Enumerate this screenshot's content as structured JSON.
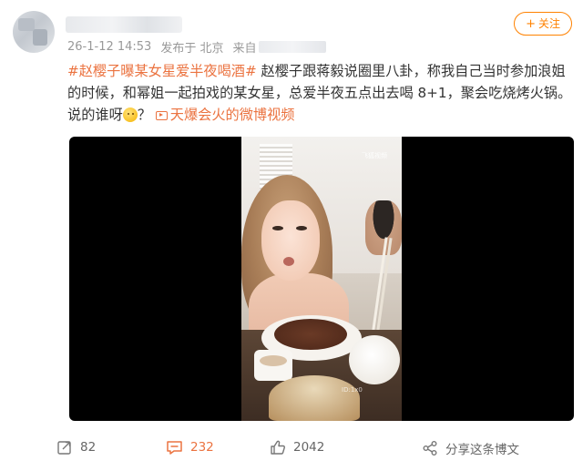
{
  "post": {
    "author": {
      "name": ""
    },
    "meta": {
      "time": "26-1-12 14:53",
      "location": "发布于 北京",
      "source_label": "来自"
    },
    "follow_label": "关注",
    "content": {
      "topic1": "#赵樱子曝某女星爱半夜喝酒#",
      "text1": " 赵樱子跟蒋毅说圈里八卦，称我自己当时参加浪姐的时候，和幂姐一起拍戏的某女星，总爱半夜五点出去喝 8+1，聚会吃烧烤火锅。说的谁呀",
      "text2": "？",
      "video_link": "天爆会火的微博视频"
    },
    "video": {
      "watermark_top": "飞狐视频",
      "watermark_bottom": "ID:1x0"
    },
    "actions": {
      "repost_count": "82",
      "comment_count": "232",
      "like_count": "2042",
      "share_label": "分享这条博文"
    },
    "icons": {
      "follow": "plus-icon",
      "emoji": "thinking-face-emoji",
      "video": "video-icon",
      "repost": "repost-icon",
      "comment": "comment-icon",
      "like": "thumbs-up-icon",
      "share": "share-icon"
    },
    "colors": {
      "accent": "#ff8200",
      "topic": "#eb7340",
      "meta_text": "#999999",
      "body_text": "#333333",
      "video_bg": "#000000"
    }
  }
}
